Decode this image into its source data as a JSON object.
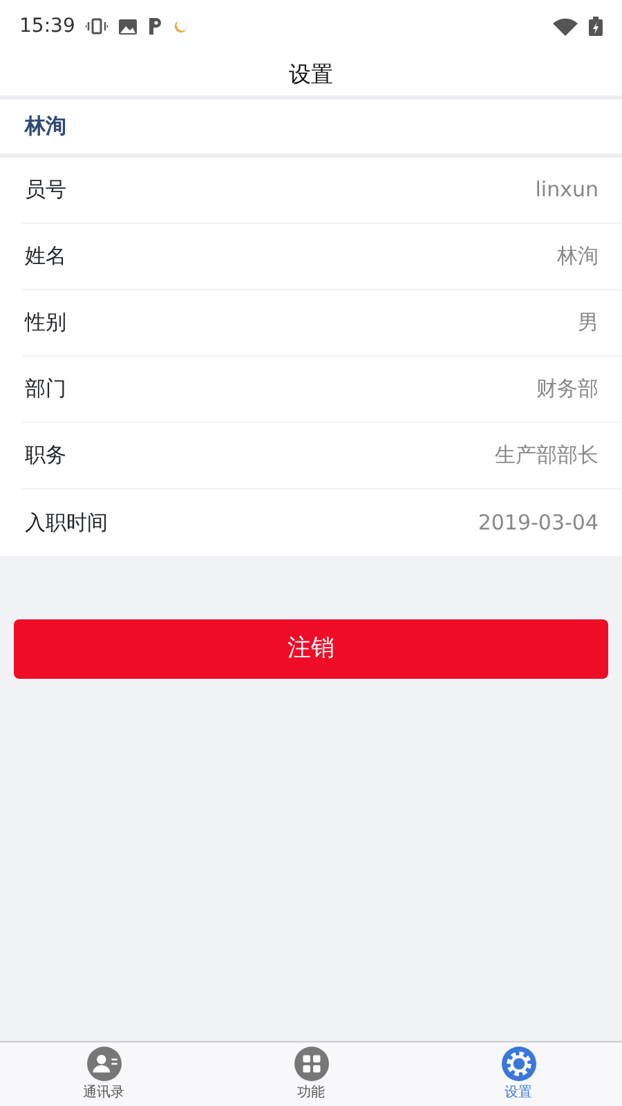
{
  "status_bar": {
    "time": "15:39"
  },
  "title": "设置",
  "user_header": "林洵",
  "fields": [
    {
      "label": "员号",
      "value": "linxun"
    },
    {
      "label": "姓名",
      "value": "林洵"
    },
    {
      "label": "性别",
      "value": "男"
    },
    {
      "label": "部门",
      "value": "财务部"
    },
    {
      "label": "职务",
      "value": "生产部部长"
    },
    {
      "label": "入职时间",
      "value": "2019-03-04"
    }
  ],
  "logout_button": "注销",
  "tabs": [
    {
      "label": "通讯录",
      "selected": false
    },
    {
      "label": "功能",
      "selected": false
    },
    {
      "label": "设置",
      "selected": true
    }
  ]
}
